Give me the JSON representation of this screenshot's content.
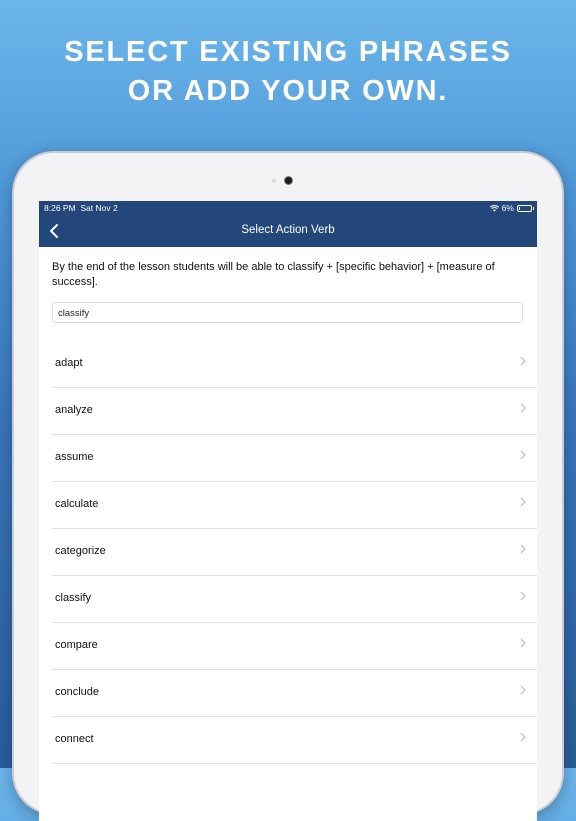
{
  "promo": {
    "line1": "SELECT EXISTING PHRASES",
    "line2": "OR ADD YOUR OWN."
  },
  "status_bar": {
    "time": "8:26 PM",
    "date": "Sat Nov 2",
    "battery_text": "6%",
    "battery_level": 0.06
  },
  "nav": {
    "title": "Select Action Verb",
    "back_icon": "chevron-left-icon"
  },
  "description": "By the end of the lesson students will be able to classify + [specific behavior] + [measure of success].",
  "search": {
    "value": "classify"
  },
  "verbs": [
    {
      "label": "adapt"
    },
    {
      "label": "analyze"
    },
    {
      "label": "assume"
    },
    {
      "label": "calculate"
    },
    {
      "label": "categorize"
    },
    {
      "label": "classify"
    },
    {
      "label": "compare"
    },
    {
      "label": "conclude"
    },
    {
      "label": "connect"
    }
  ],
  "colors": {
    "nav_background": "#23467b",
    "page_gradient_top": "#6cb6ec",
    "page_gradient_bottom": "#2a5d9c"
  }
}
